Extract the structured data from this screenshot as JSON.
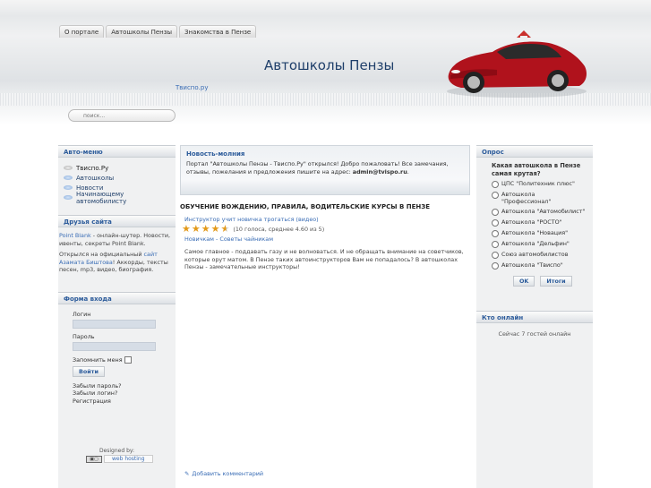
{
  "nav": {
    "tabs": [
      "О портале",
      "Автошколы Пензы",
      "Знакомства в Пензе"
    ]
  },
  "header": {
    "site_title": "Автошколы Пензы",
    "site_link": "Твиспо.ру"
  },
  "search": {
    "placeholder": "поиск..."
  },
  "left": {
    "auto_menu": {
      "title": "Авто-меню",
      "items": [
        "Твиспо.Ру",
        "Автошколы",
        "Новости",
        "Начинающему автомобилисту"
      ]
    },
    "friends": {
      "title": "Друзья сайта",
      "line1_link": "Point Blank",
      "line1_text": " - онлайн-шутер. Новости, ивенты, секреты Point Blank.",
      "line2_pre": "Открылся на официальный ",
      "line2_link": "сайт Азамата Биштова",
      "line2_post": "! Аккорды, тексты песен, mp3, видео, биография."
    },
    "login": {
      "title": "Форма входа",
      "username_label": "Логин",
      "password_label": "Пароль",
      "remember_label": "Запомнить меня",
      "submit": "Войти",
      "forgot_password": "Забыли пароль?",
      "forgot_login": "Забыли логин?",
      "register": "Регистрация"
    },
    "designed_by": "Designed by:",
    "hosting_badge": "web hosting"
  },
  "newsflash": {
    "title": "Новость-молния",
    "text_pre": "Портал \"Автошколы Пензы - Твиспо.Ру\" открылся! Добро пожаловать! Все замечания, отзывы, пожелания и предложения пишите на адрес: ",
    "email": "admin@tvispo.ru",
    "text_post": "."
  },
  "article": {
    "title": "ОБУЧЕНИЕ ВОЖДЕНИЮ, ПРАВИЛА, ВОДИТЕЛЬСКИЕ КУРСЫ В ПЕНЗЕ",
    "video_link": "Инструктор учит новичка трогаться (видео)",
    "rating_value": 4.6,
    "rating_max": 5,
    "rating_text": "(10 голоса, среднее 4.60 из 5)",
    "category": "Новичкам",
    "category_sep": " - ",
    "subcategory": "Советы чайникам",
    "body": "Самое главное - поддавать газу и не волноваться. И не обращать внимание на советчиков, которые орут матом. В Пензе таких автоинструкторов Вам не попадалось? В автошколах Пензы - замечательные инструкторы!",
    "add_comment": "Добавить комментарий"
  },
  "poll": {
    "title": "Опрос",
    "question": "Какая автошкола в Пензе самая крутая?",
    "options": [
      "ЦПС \"Политехник плюс\"",
      "Автошкола \"Профессионал\"",
      "Автошкола \"Автомобилист\"",
      "Автошкола \"РОСТО\"",
      "Автошкола \"Новация\"",
      "Автошкола \"Дельфин\"",
      "Союз автомобилистов",
      "Автошкола \"Твиспо\""
    ],
    "ok": "OK",
    "results": "Итоги"
  },
  "online": {
    "title": "Кто онлайн",
    "text": "Сейчас 7 гостей онлайн"
  },
  "colors": {
    "accent": "#2d5c9b",
    "link": "#3a6db5",
    "star": "#e39a1b",
    "car": "#b0121c"
  }
}
